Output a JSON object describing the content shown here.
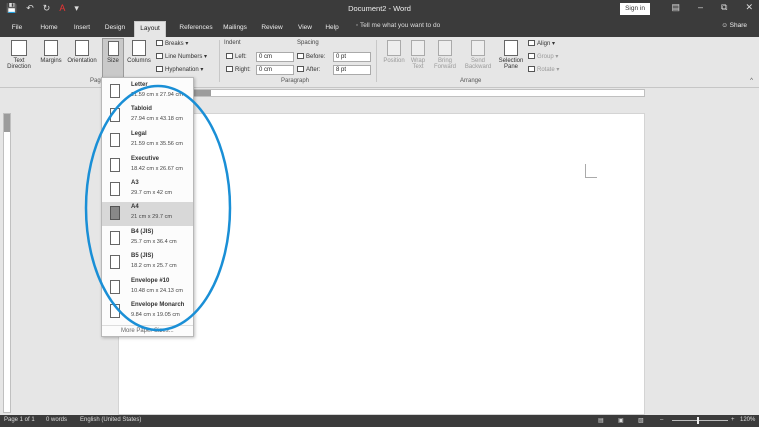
{
  "titlebar": {
    "title": "Document2  -  Word",
    "signin": "Sign in",
    "qat_icons": [
      "save-icon",
      "undo-icon",
      "redo-icon",
      "font-color-icon",
      "customize-icon"
    ]
  },
  "tabs": [
    "File",
    "Home",
    "Insert",
    "Design",
    "Layout",
    "References",
    "Mailings",
    "Review",
    "View",
    "Help"
  ],
  "active_tab": "Layout",
  "tell_me": "Tell me what you want to do",
  "share": "Share",
  "ribbon": {
    "text_direction": "Text Direction",
    "margins": "Margins",
    "orientation": "Orientation",
    "size": "Size",
    "columns": "Columns",
    "breaks": "Breaks",
    "line_numbers": "Line Numbers",
    "hyphenation": "Hyphenation",
    "page_setup_group": "Page Setup",
    "indent_label": "Indent",
    "left_label": "Left:",
    "right_label": "Right:",
    "indent_left": "0 cm",
    "indent_right": "0 cm",
    "spacing_label": "Spacing",
    "before_label": "Before:",
    "after_label": "After:",
    "spacing_before": "0 pt",
    "spacing_after": "8 pt",
    "paragraph_group": "Paragraph",
    "position": "Position",
    "wrap_text": "Wrap Text",
    "bring_forward": "Bring Forward",
    "send_backward": "Send Backward",
    "selection_pane": "Selection Pane",
    "align": "Align",
    "group": "Group",
    "rotate": "Rotate",
    "arrange_group": "Arrange"
  },
  "size_menu": {
    "items": [
      {
        "name": "Letter",
        "dims": "21.59 cm x 27.94 cm"
      },
      {
        "name": "Tabloid",
        "dims": "27.94 cm x 43.18 cm"
      },
      {
        "name": "Legal",
        "dims": "21.59 cm x 35.56 cm"
      },
      {
        "name": "Executive",
        "dims": "18.42 cm x 26.67 cm"
      },
      {
        "name": "A3",
        "dims": "29.7 cm x 42 cm"
      },
      {
        "name": "A4",
        "dims": "21 cm x 29.7 cm"
      },
      {
        "name": "B4 (JIS)",
        "dims": "25.7 cm x 36.4 cm"
      },
      {
        "name": "B5 (JIS)",
        "dims": "18.2 cm x 25.7 cm"
      },
      {
        "name": "Envelope #10",
        "dims": "10.48 cm x 24.13 cm"
      },
      {
        "name": "Envelope Monarch",
        "dims": "9.84 cm x 19.05 cm"
      }
    ],
    "selected": "A4",
    "more": "More Paper Sizes..."
  },
  "status": {
    "page": "Page 1 of 1",
    "words": "0 words",
    "language": "English (United States)",
    "zoom": "120%"
  },
  "colors": {
    "titlebar": "#3b3b3b",
    "annotation": "#1a8fd6"
  }
}
